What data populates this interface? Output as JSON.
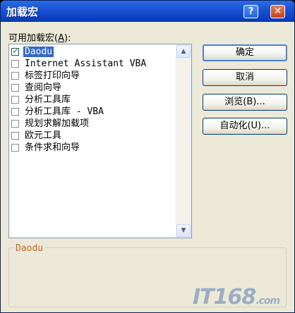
{
  "window": {
    "title": "加载宏"
  },
  "titlebar": {
    "help_glyph": "?",
    "close_glyph": "✕"
  },
  "list": {
    "label_prefix": "可用加载宏(",
    "label_key": "A",
    "label_suffix": "):",
    "items": [
      {
        "label": "Daodu",
        "checked": true,
        "selected": true
      },
      {
        "label": "Internet Assistant VBA",
        "checked": false,
        "selected": false
      },
      {
        "label": "标签打印向导",
        "checked": false,
        "selected": false
      },
      {
        "label": "查阅向导",
        "checked": false,
        "selected": false
      },
      {
        "label": "分析工具库",
        "checked": false,
        "selected": false
      },
      {
        "label": "分析工具库 - VBA",
        "checked": false,
        "selected": false
      },
      {
        "label": "规划求解加载项",
        "checked": false,
        "selected": false
      },
      {
        "label": "欧元工具",
        "checked": false,
        "selected": false
      },
      {
        "label": "条件求和向导",
        "checked": false,
        "selected": false
      }
    ]
  },
  "buttons": {
    "ok": "确定",
    "cancel": "取消",
    "browse": "浏览(B)...",
    "automation": "自动化(U)..."
  },
  "description": {
    "text": "Daodu"
  },
  "watermark": {
    "text": "IT168",
    "suffix": ".com"
  },
  "colors": {
    "titlebar": "#0c3fc0",
    "selection": "#316ac5",
    "description_text": "#d0641c",
    "face": "#ece9d8"
  }
}
